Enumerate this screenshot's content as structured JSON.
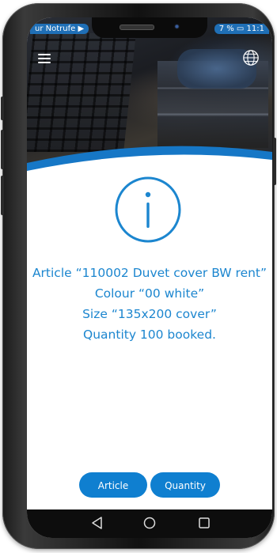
{
  "status_bar": {
    "left_text": "ur Notrufe ▶",
    "right_text": "7 % ▭ 11:1"
  },
  "icons": {
    "menu": "hamburger-menu-icon",
    "language": "globe-icon",
    "info": "info-circle-icon",
    "back": "triangle-back-icon",
    "home": "circle-home-icon",
    "recent": "square-recent-icon"
  },
  "message": {
    "line1": "Article “110002 Duvet cover BW rent”",
    "line2": "Colour “00 white”",
    "line3": "Size “135x200 cover”",
    "line4": "Quantity 100 booked."
  },
  "buttons": {
    "article": "Article",
    "quantity": "Quantity"
  },
  "colors": {
    "accent": "#1c86cf",
    "button": "#0f7fd0",
    "status_pill": "#1f6fb6"
  }
}
